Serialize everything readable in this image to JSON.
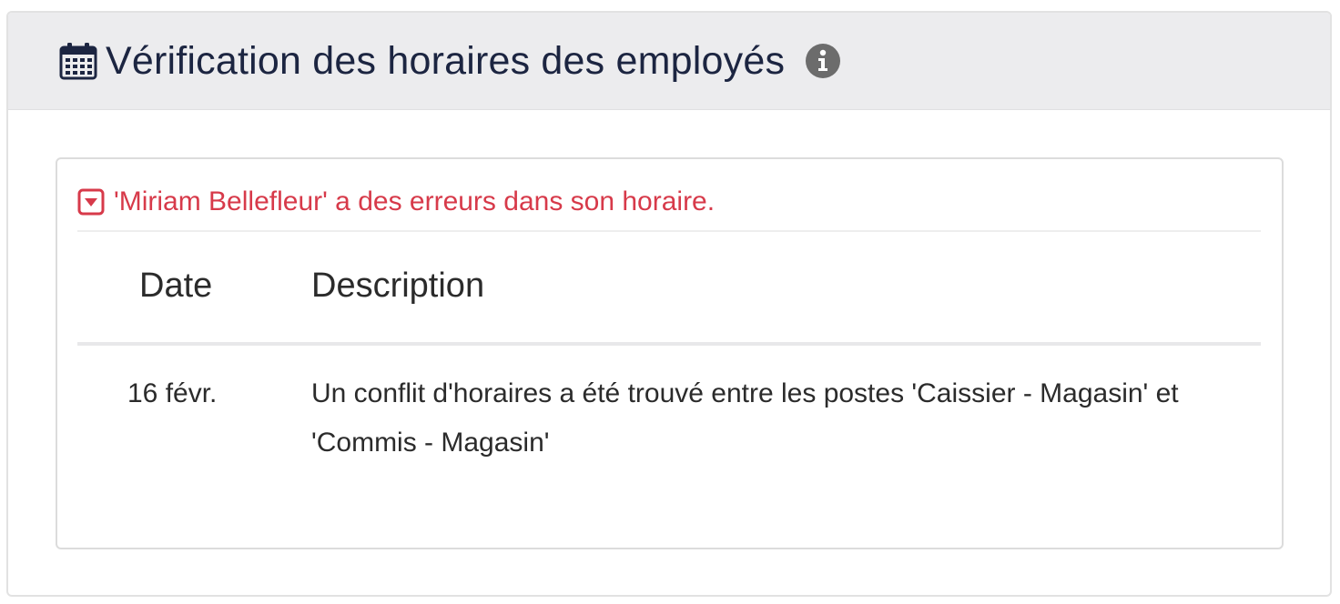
{
  "header": {
    "title": "Vérification des horaires des employés",
    "calendar_icon": "calendar-icon",
    "info_icon": "info-circle-icon"
  },
  "error": {
    "icon": "caret-square-down-icon",
    "message": "'Miriam Bellefleur' a des erreurs dans son horaire.",
    "color": "#d73a4a"
  },
  "table": {
    "columns": [
      "Date",
      "Description"
    ],
    "rows": [
      {
        "date": "16 févr.",
        "description": "Un conflit d'horaires a été trouvé entre les postes 'Caissier - Magasin' et 'Commis - Magasin'"
      }
    ]
  },
  "colors": {
    "header_bg": "#ececee",
    "title": "#1c2541",
    "info_icon": "#6c6c6c"
  }
}
